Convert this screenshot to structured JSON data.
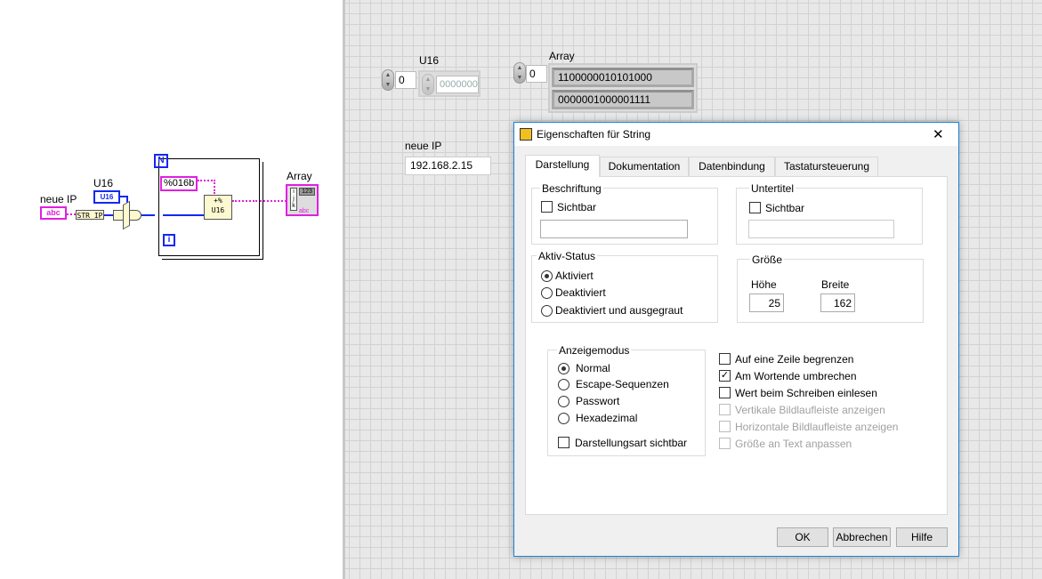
{
  "block_diagram": {
    "neue_ip_label": "neue IP",
    "neue_ip_terminal": "abc",
    "u16_label": "U16",
    "u16_terminal": "U16",
    "str_ip_node": "STR IP",
    "loop_count": "N",
    "loop_index": "i",
    "format_string": "%016b",
    "format_node_glyph": "+%",
    "format_node_type": "U16",
    "array_label": "Array",
    "array_index": [
      "i",
      "j",
      "k"
    ],
    "array_num": "123",
    "array_type": "abc"
  },
  "front_panel": {
    "u16_label": "U16",
    "u16_index": "0",
    "u16_value": "0000000",
    "array_label": "Array",
    "array_index": "0",
    "array_values": [
      "1100000010101000",
      "0000001000001111"
    ],
    "neue_ip_label": "neue IP",
    "neue_ip_value": "192.168.2.15"
  },
  "dialog": {
    "title": "Eigenschaften für String",
    "close": "✕",
    "tabs": [
      "Darstellung",
      "Dokumentation",
      "Datenbindung",
      "Tastatursteuerung"
    ],
    "active_tab": "Darstellung",
    "beschriftung": {
      "legend": "Beschriftung",
      "sichtbar": "Sichtbar",
      "checked": false,
      "text": ""
    },
    "untertitel": {
      "legend": "Untertitel",
      "sichtbar": "Sichtbar",
      "checked": false,
      "text": ""
    },
    "aktiv_status": {
      "legend": "Aktiv-Status",
      "options": [
        "Aktiviert",
        "Deaktiviert",
        "Deaktiviert und ausgegraut"
      ],
      "selected": "Aktiviert"
    },
    "groesse": {
      "legend": "Größe",
      "hoehe_label": "Höhe",
      "hoehe": "25",
      "breite_label": "Breite",
      "breite": "162"
    },
    "anzeigemodus": {
      "legend": "Anzeigemodus",
      "options": [
        "Normal",
        "Escape-Sequenzen",
        "Passwort",
        "Hexadezimal"
      ],
      "selected": "Normal",
      "darstellungsart": "Darstellungsart sichtbar",
      "darstellungsart_checked": false
    },
    "options": [
      {
        "label": "Auf eine Zeile begrenzen",
        "checked": false,
        "enabled": true
      },
      {
        "label": "Am Wortende umbrechen",
        "checked": true,
        "enabled": true
      },
      {
        "label": "Wert beim Schreiben einlesen",
        "checked": false,
        "enabled": true
      },
      {
        "label": "Vertikale Bildlaufleiste anzeigen",
        "checked": false,
        "enabled": false
      },
      {
        "label": "Horizontale Bildlaufleiste anzeigen",
        "checked": false,
        "enabled": false
      },
      {
        "label": "Größe an Text anpassen",
        "checked": false,
        "enabled": false
      }
    ],
    "buttons": {
      "ok": "OK",
      "cancel": "Abbrechen",
      "help": "Hilfe"
    }
  }
}
